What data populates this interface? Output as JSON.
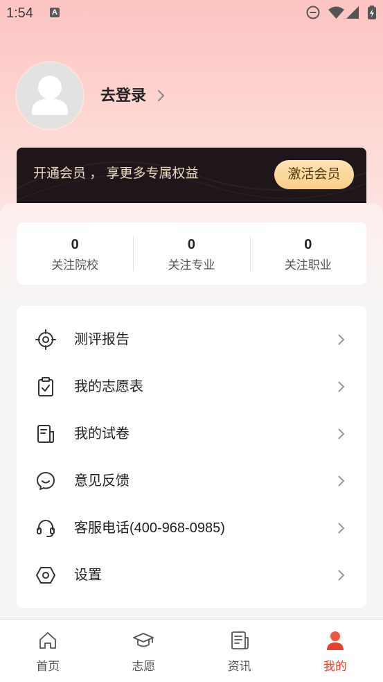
{
  "status_bar": {
    "time": "1:54",
    "notification_glyph": "A",
    "icons": [
      "notification-a-icon",
      "do-not-disturb-icon",
      "wifi-icon",
      "signal-icon",
      "battery-charging-icon"
    ]
  },
  "profile": {
    "login_label": "去登录",
    "avatar_icon": "default-avatar-icon"
  },
  "vip_banner": {
    "text": "开通会员 ， 享更多专属权益",
    "button_label": "激活会员"
  },
  "stats": [
    {
      "value": "0",
      "label": "关注院校"
    },
    {
      "value": "0",
      "label": "关注专业"
    },
    {
      "value": "0",
      "label": "关注职业"
    }
  ],
  "menu": [
    {
      "label": "测评报告",
      "icon": "target-icon"
    },
    {
      "label": "我的志愿表",
      "icon": "clipboard-check-icon"
    },
    {
      "label": "我的试卷",
      "icon": "exam-paper-icon"
    },
    {
      "label": "意见反馈",
      "icon": "feedback-chat-icon"
    },
    {
      "label": "客服电话(400-968-0985)",
      "icon": "headset-icon"
    },
    {
      "label": "设置",
      "icon": "settings-hexagon-icon"
    }
  ],
  "tab_bar": {
    "active_index": 3,
    "items": [
      {
        "label": "首页",
        "icon": "home-icon"
      },
      {
        "label": "志愿",
        "icon": "graduation-cap-icon"
      },
      {
        "label": "资讯",
        "icon": "news-icon"
      },
      {
        "label": "我的",
        "icon": "user-icon"
      }
    ]
  },
  "colors": {
    "accent": "#e8412f",
    "header_gradient_top": "#fcc4c2",
    "banner_bg": "#1e1618",
    "banner_text": "#e8d8c4",
    "vip_button": "#fbd693",
    "vip_button_text": "#5a3512"
  }
}
